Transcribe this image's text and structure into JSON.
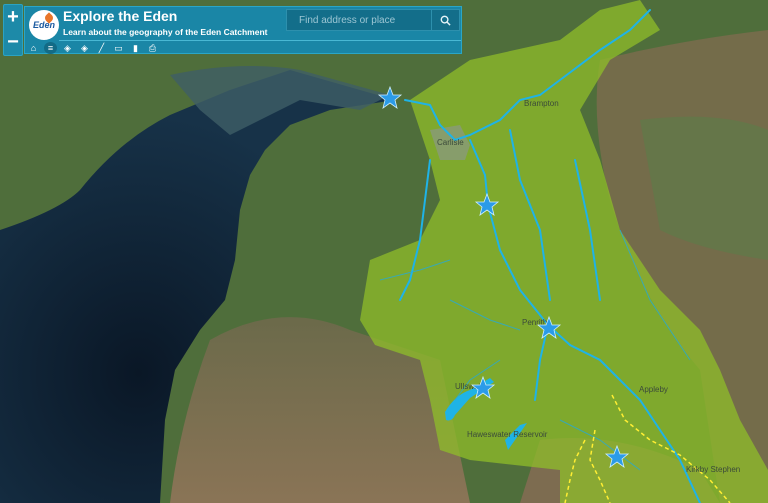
{
  "app": {
    "title": "Explore the Eden",
    "subtitle": "Learn about the geography of the Eden Catchment",
    "logo_text": "Eden"
  },
  "zoom": {
    "in_label": "+",
    "out_label": "−"
  },
  "toolbar": [
    {
      "name": "home-icon",
      "glyph": "⌂",
      "active": false
    },
    {
      "name": "list-icon",
      "glyph": "≡",
      "active": true
    },
    {
      "name": "layers-icon",
      "glyph": "◈",
      "active": false
    },
    {
      "name": "basemap-icon",
      "glyph": "◈",
      "active": false
    },
    {
      "name": "draw-icon",
      "glyph": "╱",
      "active": false
    },
    {
      "name": "comment-icon",
      "glyph": "▭",
      "active": false
    },
    {
      "name": "bookmark-icon",
      "glyph": "▮",
      "active": false
    },
    {
      "name": "print-icon",
      "glyph": "⎙",
      "active": false
    }
  ],
  "search": {
    "placeholder": "Find address or place",
    "button_icon": "search-icon"
  },
  "map": {
    "place_labels": [
      "Brampton",
      "Carlisle",
      "Penrith",
      "Ullswater",
      "Haweswater Reservoir",
      "Appleby",
      "Kirkby Stephen"
    ],
    "markers": [
      "star-marker-1",
      "star-marker-2",
      "star-marker-3",
      "star-marker-4",
      "star-marker-5"
    ],
    "colors": {
      "sea": "#0e1e2d",
      "land": "#4e6b3a",
      "catchment": "#8fbd2a",
      "rivers": "#1fb3e6",
      "boundary": "#ffee33",
      "star": "#2b9be8"
    }
  }
}
